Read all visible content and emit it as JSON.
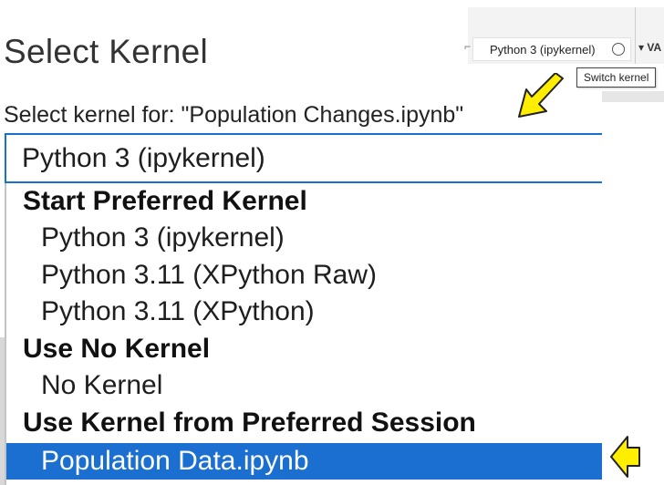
{
  "toolbar": {
    "kernel_button_label": "Python 3 (ipykernel)",
    "partial_right_label": "VA",
    "tooltip": "Switch kernel"
  },
  "dialog": {
    "title": "Select Kernel",
    "subtitle": "Select kernel for: \"Population Changes.ipynb\"",
    "current_value": "Python 3 (ipykernel)"
  },
  "dropdown": {
    "groups": [
      {
        "header": "Start Preferred Kernel",
        "items": [
          "Python 3 (ipykernel)",
          "Python 3.11 (XPython Raw)",
          "Python 3.11 (XPython)"
        ]
      },
      {
        "header": "Use No Kernel",
        "items": [
          "No Kernel"
        ]
      },
      {
        "header": "Use Kernel from Preferred Session",
        "items": [
          "Population Data.ipynb"
        ]
      }
    ],
    "selected_item": "Population Data.ipynb"
  },
  "colors": {
    "accent": "#1a6fd0",
    "annotation_arrow": "#ffee00"
  }
}
